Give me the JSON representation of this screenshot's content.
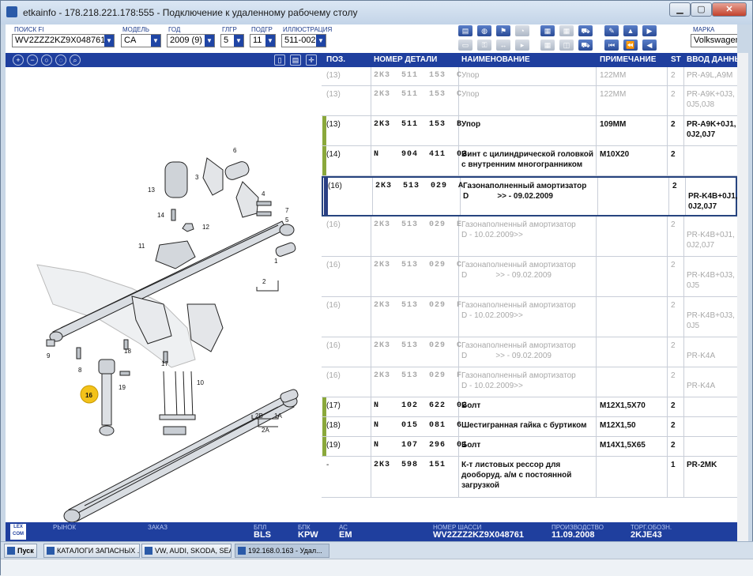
{
  "window": {
    "title": "etkainfo - 178.218.221.178:555 - Подключение к удаленному рабочему столу",
    "btn_min": "▁",
    "btn_max": "▢",
    "btn_close": "✕"
  },
  "filters": {
    "search_label": "ПОИСК FI",
    "search_value": "WV2ZZZ2KZ9X048761",
    "model_label": "МОДЕЛЬ",
    "model_value": "CA",
    "year_label": "ГОД",
    "year_value": "2009 (9)",
    "glgr_label": "ГЛГР",
    "glgr_value": "5",
    "podgr_label": "ПОДГР",
    "podgr_value": "11",
    "illus_label": "ИЛЛЮСТРАЦИЯ",
    "illus_value": "511-002",
    "brand_label": "МАРКА",
    "brand_value": "Volkswagen"
  },
  "table": {
    "headers": [
      "ПОЗ.",
      "НОМЕР ДЕТАЛИ",
      "НАИМЕНОВАНИЕ",
      "ПРИМЕЧАНИЕ",
      "ST",
      "ВВОД ДАННЫ"
    ],
    "rows": [
      {
        "pos": "(13)",
        "pn": "2К3  511  153  С",
        "name": "Упор",
        "note": "122ММ",
        "st": "2",
        "input": "PR-A9L,A9M",
        "dim": true,
        "mark": "",
        "h": 24
      },
      {
        "pos": "(13)",
        "pn": "2К3  511  153  С",
        "name": "Упор",
        "note": "122ММ",
        "st": "2",
        "input": "PR-A9K+0J3,\n0J5,0J8",
        "dim": true,
        "mark": "",
        "h": 38
      },
      {
        "pos": "(13)",
        "pn": "2К3  511  153  В",
        "name": "Упор",
        "note": "109ММ",
        "st": "2",
        "input": "PR-A9K+0J1,\n0J2,0J7",
        "dim": false,
        "mark": "#8aa83b",
        "h": 38
      },
      {
        "pos": "(14)",
        "pn": "N    904  411  03",
        "name": "Винт с цилиндрической головкой\nс внутренним многогранником",
        "note": "М10Х20",
        "st": "2",
        "input": "",
        "dim": false,
        "mark": "#8aa83b",
        "h": 38
      },
      {
        "pos": "(16)",
        "pn": "2К3  513  029  А",
        "name": "Газонаполненный амортизатор\nD             >> - 09.02.2009",
        "note": "",
        "st": "2",
        "input": "\nPR-K4B+0J1,\n0J2,0J7",
        "dim": false,
        "mark": "#2a3f84",
        "h": 51,
        "sel": true
      },
      {
        "pos": "(16)",
        "pn": "2К3  513  029  Е",
        "name": "Газонаполненный амортизатор\nD - 10.02.2009>>",
        "note": "",
        "st": "2",
        "input": "\nPR-K4B+0J1,\n0J2,0J7",
        "dim": true,
        "mark": "",
        "h": 51
      },
      {
        "pos": "(16)",
        "pn": "2К3  513  029  С",
        "name": "Газонаполненный амортизатор\nD             >> - 09.02.2009",
        "note": "",
        "st": "2",
        "input": "\nPR-K4B+0J3,\n0J5",
        "dim": true,
        "mark": "",
        "h": 51
      },
      {
        "pos": "(16)",
        "pn": "2К3  513  029  F",
        "name": "Газонаполненный амортизатор\nD - 10.02.2009>>",
        "note": "",
        "st": "2",
        "input": "\nPR-K4B+0J3,\n0J5",
        "dim": true,
        "mark": "",
        "h": 51
      },
      {
        "pos": "(16)",
        "pn": "2К3  513  029  С",
        "name": "Газонаполненный амортизатор\nD             >> - 09.02.2009",
        "note": "",
        "st": "2",
        "input": "\nPR-K4A",
        "dim": true,
        "mark": "",
        "h": 38
      },
      {
        "pos": "(16)",
        "pn": "2К3  513  029  F",
        "name": "Газонаполненный амортизатор\nD - 10.02.2009>>",
        "note": "",
        "st": "2",
        "input": "\nPR-K4A",
        "dim": true,
        "mark": "",
        "h": 38
      },
      {
        "pos": "(17)",
        "pn": "N    102  622  02",
        "name": "Болт",
        "note": "М12Х1,5Х70",
        "st": "2",
        "input": "",
        "dim": false,
        "mark": "#8aa83b",
        "h": 25
      },
      {
        "pos": "(18)",
        "pn": "N    015  081  6",
        "name": "Шестигранная гайка с буртиком",
        "note": "М12Х1,50",
        "st": "2",
        "input": "",
        "dim": false,
        "mark": "#8aa83b",
        "h": 25
      },
      {
        "pos": "(19)",
        "pn": "N    107  296  01",
        "name": "Болт",
        "note": "М14Х1,5Х65",
        "st": "2",
        "input": "",
        "dim": false,
        "mark": "#8aa83b",
        "h": 25
      },
      {
        "pos": "-",
        "pn": "2К3  598  151",
        "name": "К-т листовых рессор для\nдооборуд. а/м с постоянной\nзагрузкой",
        "note": "",
        "st": "1",
        "input": "PR-2MK",
        "dim": false,
        "mark": "",
        "h": 52
      }
    ]
  },
  "diagram": {
    "labels": [
      "6",
      "3",
      "13",
      "4",
      "14",
      "12",
      "7",
      "5",
      "11",
      "1",
      "2",
      "9",
      "8",
      "18",
      "17",
      "10",
      "16",
      "19",
      "2В",
      "1А",
      "2А"
    ]
  },
  "status": {
    "market_label": "РЫНОК",
    "market_value": "",
    "order_label": "ЗАКАЗ",
    "order_value": "",
    "bpl_label": "БПЛ",
    "bpl_value": "BLS",
    "bpk_label": "БПК",
    "bpk_value": "KPW",
    "ac_label": "АС",
    "ac_value": "EM",
    "chassis_label": "НОМЕР ШАССИ",
    "chassis_value": "WV2ZZZ2KZ9X048761",
    "prod_label": "ПРОИЗВОДСТВО",
    "prod_value": "11.09.2008",
    "trade_label": "ТОРГ.ОБОЗН.",
    "trade_value": "2KJE43",
    "logo_text": "LEX\nCOM"
  },
  "taskbar": {
    "start": "Пуск",
    "t1": "КАТАЛОГИ ЗАПАСНЫХ ...",
    "t2": "VW, AUDI, SKODA, SEAT",
    "t3": "192.168.0.163 - Удал..."
  },
  "colors": {
    "brand_blue": "#1f3f9e",
    "accent_green": "#8aa83b",
    "highlight_yellow": "#f3c21a"
  }
}
